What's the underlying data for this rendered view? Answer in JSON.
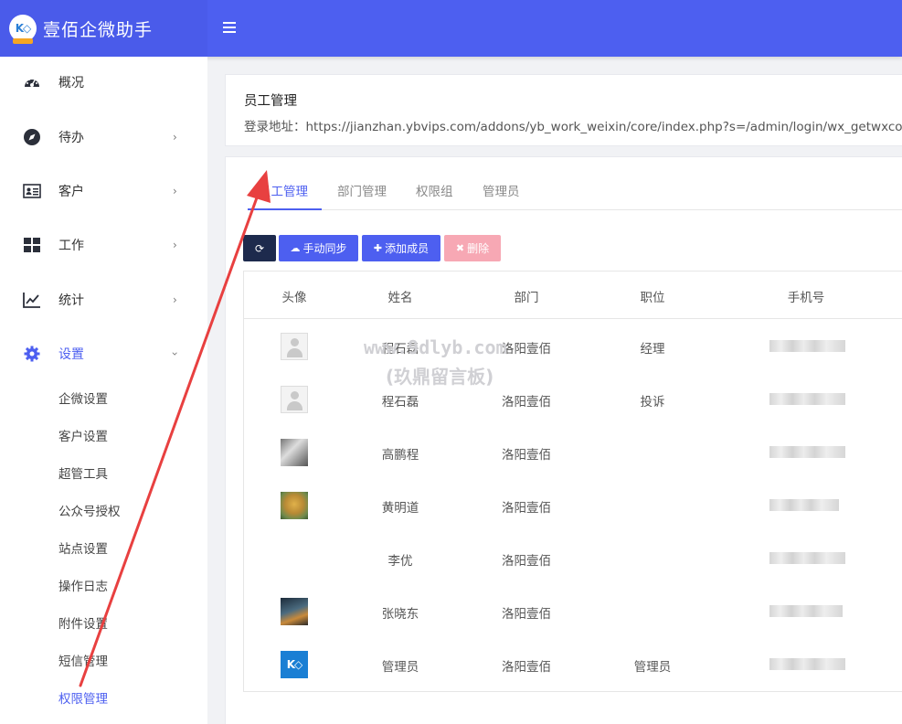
{
  "app": {
    "title": "壹佰企微助手"
  },
  "sidebar": {
    "items": [
      {
        "label": "概况",
        "icon": "dashboard-icon",
        "has_chevron": false
      },
      {
        "label": "待办",
        "icon": "compass-icon",
        "has_chevron": true
      },
      {
        "label": "客户",
        "icon": "id-card-icon",
        "has_chevron": true
      },
      {
        "label": "工作",
        "icon": "grid-icon",
        "has_chevron": true
      },
      {
        "label": "统计",
        "icon": "line-chart-icon",
        "has_chevron": true
      },
      {
        "label": "设置",
        "icon": "gear-icon",
        "has_chevron": true,
        "expanded": true
      }
    ],
    "submenu": [
      "企微设置",
      "客户设置",
      "超管工具",
      "公众号授权",
      "站点设置",
      "操作日志",
      "附件设置",
      "短信管理",
      "权限管理"
    ],
    "current_submenu": "权限管理"
  },
  "header_card": {
    "title": "员工管理",
    "url_label": "登录地址：https://jianzhan.ybvips.com/addons/yb_work_weixin/core/index.php?s=/admin/login/wx_getwxco"
  },
  "tabs": [
    "员工管理",
    "部门管理",
    "权限组",
    "管理员"
  ],
  "active_tab": "员工管理",
  "toolbar": {
    "refresh_icon": "refresh-icon",
    "sync_label": "手动同步",
    "add_label": "添加成员",
    "delete_label": "删除"
  },
  "table": {
    "columns": [
      "头像",
      "姓名",
      "部门",
      "职位",
      "手机号"
    ],
    "rows": [
      {
        "avatar": "default-avatar",
        "name": "程石磊",
        "dept": "洛阳壹佰",
        "position": "经理",
        "phone": ""
      },
      {
        "avatar": "default-avatar",
        "name": "程石磊",
        "dept": "洛阳壹佰",
        "position": "投诉",
        "phone": ""
      },
      {
        "avatar": "photo-avatar",
        "name": "高鹏程",
        "dept": "洛阳壹佰",
        "position": "",
        "phone": ""
      },
      {
        "avatar": "photo-avatar",
        "name": "黄明道",
        "dept": "洛阳壹佰",
        "position": "",
        "phone": ""
      },
      {
        "avatar": "",
        "name": "李优",
        "dept": "洛阳壹佰",
        "position": "",
        "phone": ""
      },
      {
        "avatar": "photo-avatar",
        "name": "张晓东",
        "dept": "洛阳壹佰",
        "position": "",
        "phone": ""
      },
      {
        "avatar": "logo-avatar",
        "name": "管理员",
        "dept": "洛阳壹佰",
        "position": "管理员",
        "phone": ""
      }
    ]
  },
  "watermark": {
    "line1": "www.9dlyb.com",
    "line2": "(玖鼎留言板)"
  },
  "colors": {
    "primary": "#4d5ff0",
    "dark_button": "#1d2a4d",
    "danger_light": "#f7a8b4",
    "annotation_arrow": "#e84040"
  }
}
